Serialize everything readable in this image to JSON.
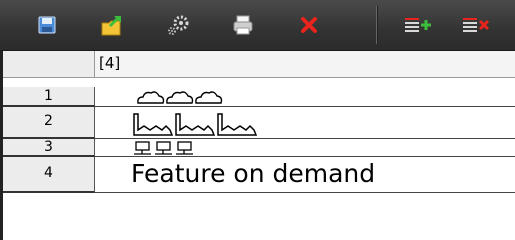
{
  "toolbar": {
    "buttons": [
      {
        "name": "save",
        "icon": "floppy-disk-icon"
      },
      {
        "name": "export",
        "icon": "folder-arrow-icon"
      },
      {
        "name": "settings",
        "icon": "gears-icon"
      },
      {
        "name": "print",
        "icon": "printer-icon"
      },
      {
        "name": "delete",
        "icon": "red-x-icon"
      },
      {
        "name": "add-row",
        "icon": "list-plus-icon"
      },
      {
        "name": "delete-row",
        "icon": "list-x-icon"
      }
    ],
    "colors": {
      "background": "#333333",
      "accent_green": "#3cbe3c",
      "accent_red": "#e8241c",
      "accent_blue": "#3a7dc8"
    }
  },
  "grid": {
    "column_header": "[4]",
    "rows": [
      {
        "number": "1",
        "content_type": "cloud-glyphs"
      },
      {
        "number": "2",
        "content_type": "factory-glyphs"
      },
      {
        "number": "3",
        "content_type": "computer-glyphs"
      },
      {
        "number": "4",
        "content_type": "text",
        "text": "Feature on demand"
      }
    ]
  }
}
